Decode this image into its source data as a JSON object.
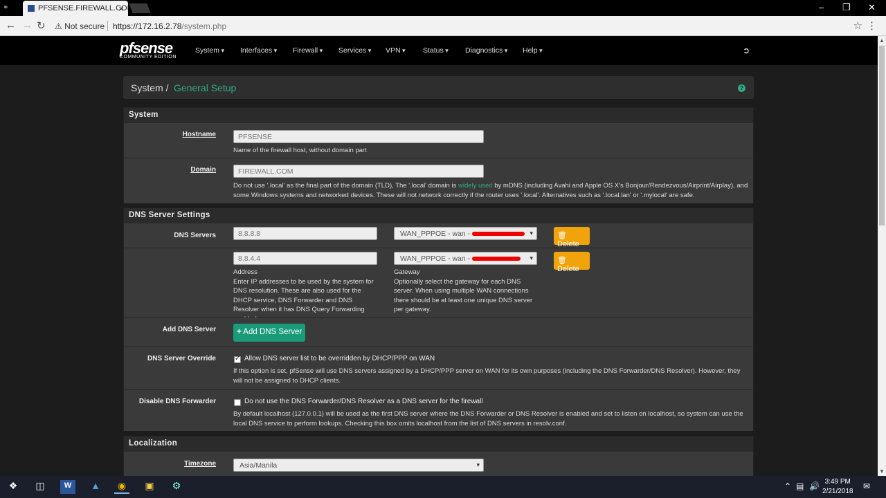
{
  "browser": {
    "tab_title": "PFSENSE.FIREWALL.COM",
    "security": "Not secure",
    "url_host": "https://172.16.2.78",
    "url_path": "/system.php"
  },
  "nav": {
    "logo_brand": "pfsense",
    "logo_sub": "COMMUNITY EDITION",
    "items": [
      "System",
      "Interfaces",
      "Firewall",
      "Services",
      "VPN",
      "Status",
      "Diagnostics",
      "Help"
    ]
  },
  "breadcrumb": {
    "parent": "System /",
    "current": "General Setup"
  },
  "system_panel": {
    "title": "System",
    "hostname_label": "Hostname",
    "hostname_value": "PFSENSE",
    "hostname_help": "Name of the firewall host, without domain part",
    "domain_label": "Domain",
    "domain_value": "FIREWALL.COM",
    "domain_help_pre": "Do not use '.local' as the final part of the domain (TLD), The '.local' domain is ",
    "domain_help_link": "widely used",
    "domain_help_post": " by mDNS (including Avahi and Apple OS X's Bonjour/Rendezvous/Airprint/Airplay), and some Windows systems and networked devices. These will not network correctly if the router uses '.local'. Alternatives such as '.local.lan' or '.mylocal' are safe."
  },
  "dns_panel": {
    "title": "DNS Server Settings",
    "servers_label": "DNS Servers",
    "servers": [
      {
        "address": "8.8.8.8",
        "gateway": "WAN_PPPOE - wan -"
      },
      {
        "address": "8.8.4.4",
        "gateway": "WAN_PPPOE - wan -"
      }
    ],
    "delete_label": "Delete",
    "address_caption": "Address",
    "address_help": "Enter IP addresses to be used by the system for DNS resolution. These are also used for the DHCP service, DNS Forwarder and DNS Resolver when it has DNS Query Forwarding enabled.",
    "gateway_caption": "Gateway",
    "gateway_help": "Optionally select the gateway for each DNS server. When using multiple WAN connections there should be at least one unique DNS server per gateway.",
    "add_label": "Add DNS Server",
    "add_button": "Add DNS Server",
    "override_label": "DNS Server Override",
    "override_check": "Allow DNS server list to be overridden by DHCP/PPP on WAN",
    "override_help": "If this option is set, pfSense will use DNS servers assigned by a DHCP/PPP server on WAN for its own purposes (including the DNS Forwarder/DNS Resolver). However, they will not be assigned to DHCP clients.",
    "disable_label": "Disable DNS Forwarder",
    "disable_check": "Do not use the DNS Forwarder/DNS Resolver as a DNS server for the firewall",
    "disable_help": "By default localhost (127.0.0.1) will be used as the first DNS server where the DNS Forwarder or DNS Resolver is enabled and set to listen on localhost, so system can use the local DNS service to perform lookups. Checking this box omits localhost from the list of DNS servers in resolv.conf."
  },
  "localization_panel": {
    "title": "Localization",
    "timezone_label": "Timezone",
    "timezone_value": "Asia/Manila"
  },
  "taskbar": {
    "time": "3:49 PM",
    "date": "2/21/2018"
  }
}
